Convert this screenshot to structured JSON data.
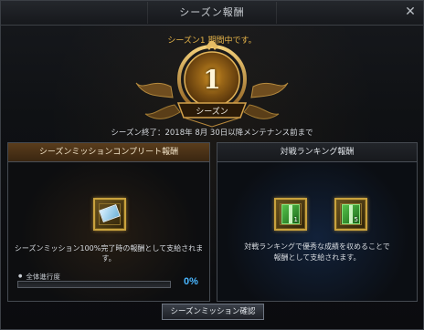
{
  "window": {
    "title": "シーズン報酬",
    "close_icon": "close-icon"
  },
  "season": {
    "status": "シーズン1 期間中です。",
    "number": "1",
    "label": "シーズン",
    "end_notice": "シーズン終了：2018年 8月 30日以降メンテナンス前まで"
  },
  "mission_panel": {
    "header": "シーズンミッションコンプリート報酬",
    "reward_icon": "ticket-icon",
    "description": "シーズンミッション100%完了時の報酬として支給されます。",
    "progress_label": "全体進行度",
    "progress_value": 0,
    "progress_text": "0%"
  },
  "ranking_panel": {
    "header": "対戦ランキング報酬",
    "reward_icons": [
      "box-icon-1",
      "box-icon-5"
    ],
    "reward_counts": [
      "1",
      "5"
    ],
    "description_line1": "対戦ランキングで優秀な成績を収めることで",
    "description_line2": "報酬として支給されます。"
  },
  "footer": {
    "confirm_button": "シーズンミッション確認"
  },
  "colors": {
    "gold": "#e9b64a",
    "progress_blue": "#49b6ff"
  }
}
